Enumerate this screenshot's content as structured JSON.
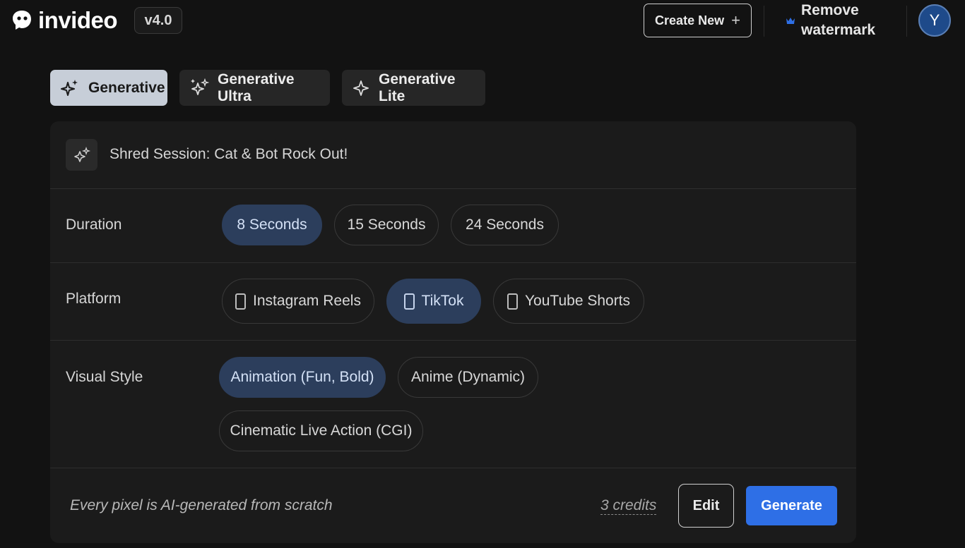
{
  "header": {
    "brand": "invideo",
    "version": "v4.0",
    "create_new_label": "Create New",
    "remove_watermark_label": "Remove watermark",
    "avatar_initial": "Y"
  },
  "modes": [
    {
      "label": "Generative",
      "active": true
    },
    {
      "label": "Generative Ultra",
      "active": false
    },
    {
      "label": "Generative Lite",
      "active": false
    }
  ],
  "prompt": {
    "title": "Shred Session: Cat & Bot Rock Out!"
  },
  "duration": {
    "label": "Duration",
    "options": [
      {
        "label": "8 Seconds",
        "selected": true
      },
      {
        "label": "15 Seconds",
        "selected": false
      },
      {
        "label": "24 Seconds",
        "selected": false
      }
    ]
  },
  "platform": {
    "label": "Platform",
    "options": [
      {
        "label": "Instagram Reels",
        "selected": false
      },
      {
        "label": "TikTok",
        "selected": true
      },
      {
        "label": "YouTube Shorts",
        "selected": false
      }
    ]
  },
  "visual_style": {
    "label": "Visual Style",
    "options": [
      {
        "label": "Animation (Fun, Bold)",
        "selected": true
      },
      {
        "label": "Anime (Dynamic)",
        "selected": false
      },
      {
        "label": "Cinematic Live Action (CGI)",
        "selected": false
      }
    ]
  },
  "footer": {
    "note": "Every pixel is AI-generated from scratch",
    "credits": "3 credits",
    "edit_label": "Edit",
    "generate_label": "Generate"
  },
  "colors": {
    "background": "#121212",
    "panel": "#1b1b1b",
    "accent": "#2e6fe6",
    "selected_chip": "#2c3e5c"
  }
}
